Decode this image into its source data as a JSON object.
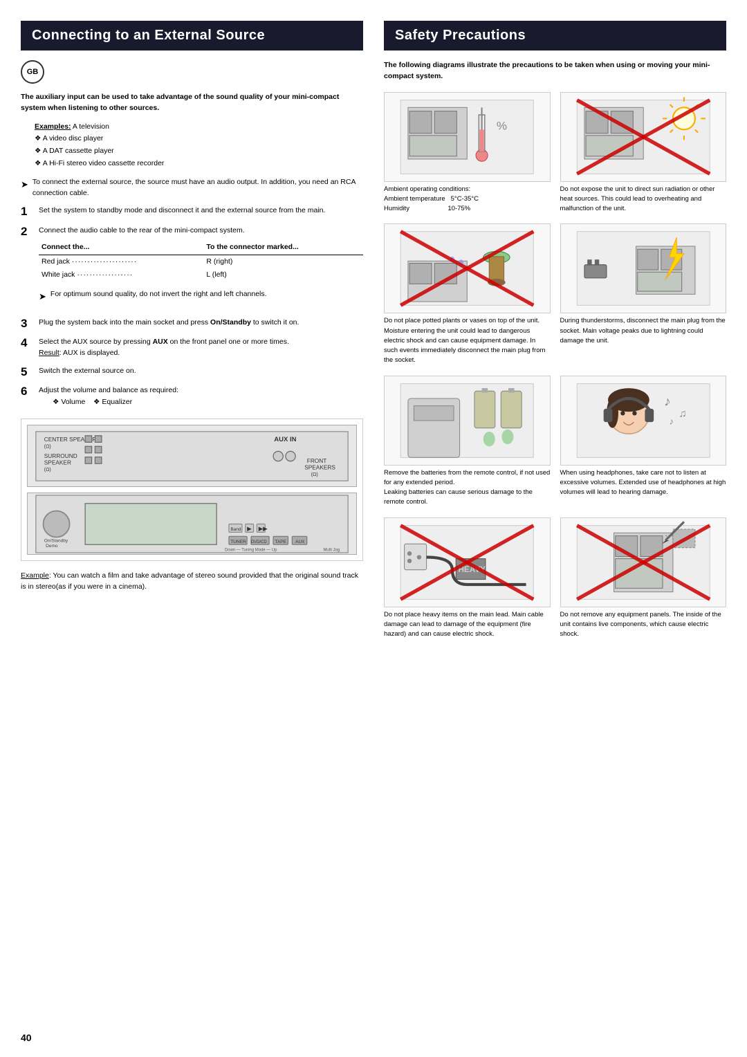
{
  "left": {
    "section_title": "Connecting to an External Source",
    "gb_label": "GB",
    "intro": "The auxiliary input can be used to take advantage of the sound quality of your mini-compact system when listening to other sources.",
    "examples_label": "Examples:",
    "examples": [
      "❖ A television",
      "❖ A video disc player",
      "❖ A DAT cassette player",
      "❖ A Hi-Fi stereo video cassette recorder"
    ],
    "note1": "To connect the external source, the source must have an audio output. In addition, you need an RCA connection cable.",
    "steps": [
      {
        "num": "1",
        "text": "Set the system to standby mode and disconnect it and the external source from the main."
      },
      {
        "num": "2",
        "text": "Connect the audio cable to the rear of the mini-compact system."
      }
    ],
    "connect_table": {
      "col1": "Connect the...",
      "col2": "To the connector marked...",
      "rows": [
        {
          "c1": "Red jack",
          "dots": "................................",
          "c2": "R (right)"
        },
        {
          "c1": "White jack",
          "dots": "................................",
          "c2": "L (left)"
        }
      ]
    },
    "note2": "For optimum sound quality, do not invert the right and left channels.",
    "steps2": [
      {
        "num": "3",
        "text": "Plug the system back into the main socket and press",
        "bold_part": "On/Standby",
        "text2": "to switch it on."
      },
      {
        "num": "4",
        "text": "Select the AUX source by pressing",
        "bold_part": "AUX",
        "text2": "on the front panel one or more times.",
        "result": "AUX is displayed."
      },
      {
        "num": "5",
        "text": "Switch the external source on."
      },
      {
        "num": "6",
        "text": "Adjust the volume and balance as required:",
        "subs": [
          "❖ Volume",
          "❖ Equalizer"
        ]
      }
    ],
    "example_note": "Example: You can watch a film and take advantage of stereo sound provided that the original sound track is in stereo(as if you were in a cinema)."
  },
  "right": {
    "section_title": "Safety Precautions",
    "intro": "The following diagrams illustrate the precautions to be taken when using or moving your mini-compact system.",
    "items": [
      {
        "id": "ambient",
        "has_cross": false,
        "desc": "Ambient operating conditions:\nAmbient temperature    5°C-35°C\nHumidity                       10-75%"
      },
      {
        "id": "sun",
        "has_cross": true,
        "desc": "Do not expose the unit to direct sun radiation or other heat sources. This could lead to overheating and malfunction of the unit."
      },
      {
        "id": "plants",
        "has_cross": true,
        "desc": "Do not place potted plants or vases on top of the unit. Moisture entering the unit could lead to dangerous electric shock and can cause equipment damage. In such events immediately disconnect the main plug from the socket."
      },
      {
        "id": "thunder",
        "has_cross": false,
        "desc": "During thunderstorms, disconnect the main plug from the socket. Main voltage peaks due to lightning could damage the unit."
      },
      {
        "id": "batteries",
        "has_cross": false,
        "desc": "Remove the batteries from the remote control, if not used for any extended period.\nLeaking batteries can cause serious damage to the remote control."
      },
      {
        "id": "headphones",
        "has_cross": false,
        "desc": "When using headphones, take care not to listen at excessive volumes. Extended use of headphones at high volumes will lead to hearing damage."
      },
      {
        "id": "cable",
        "has_cross": true,
        "desc": "Do not place heavy items on the main lead. Main cable damage can lead to damage of the equipment (fire hazard) and can cause electric shock."
      },
      {
        "id": "panels",
        "has_cross": true,
        "desc": "Do not remove any equipment panels. The inside of the unit contains live components, which cause electric shock."
      }
    ]
  },
  "page_number": "40"
}
